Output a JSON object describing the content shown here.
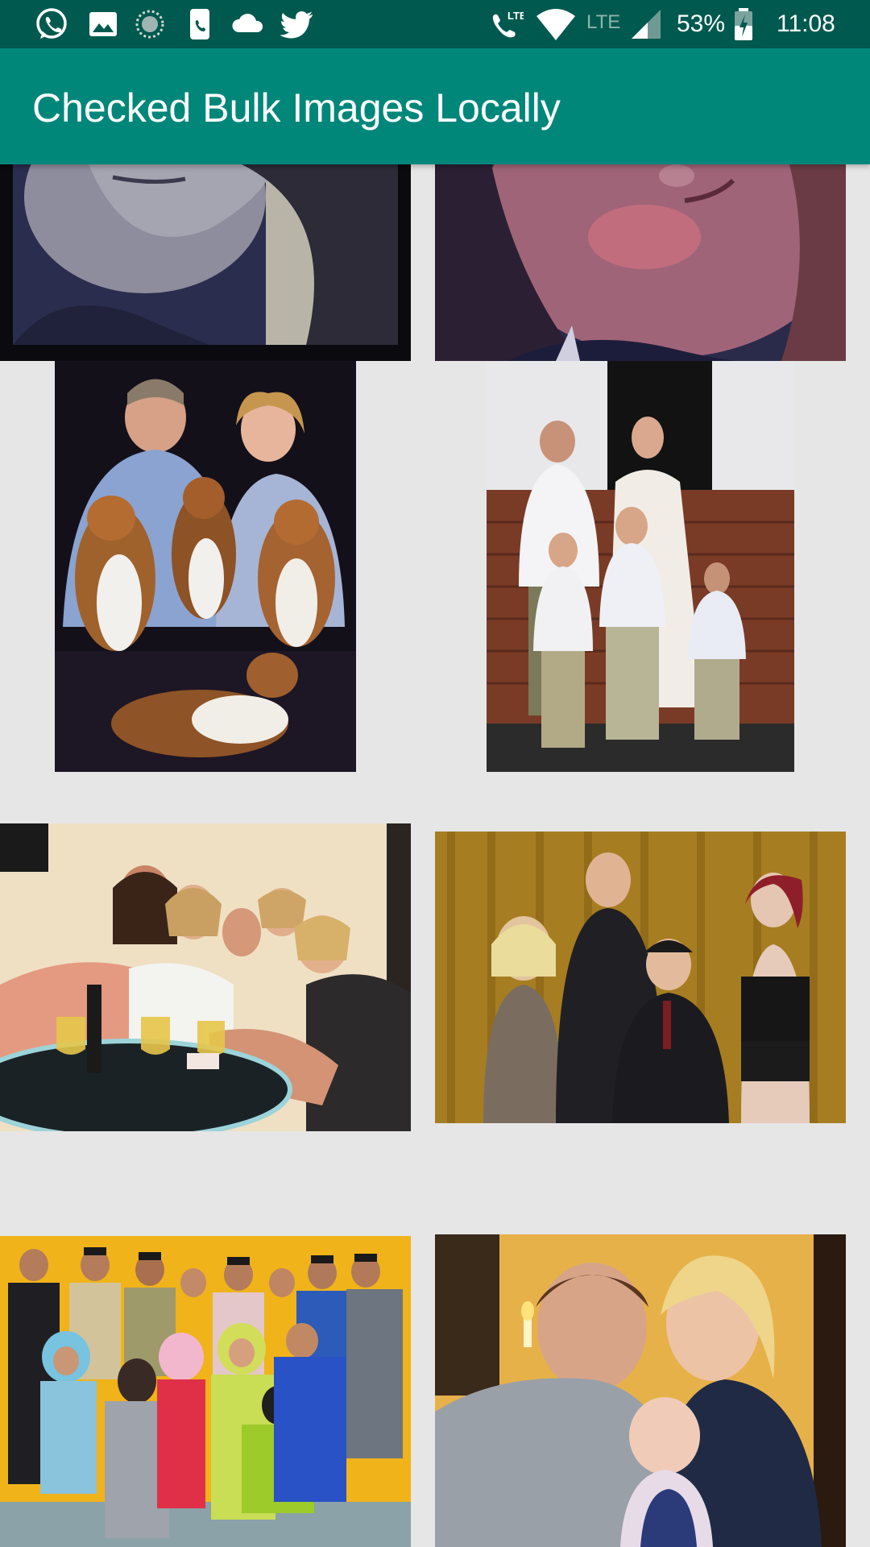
{
  "status_bar": {
    "battery": "53%",
    "time": "11:08",
    "network_label": "LTE",
    "icons": [
      "whatsapp-icon",
      "gallery-icon",
      "sync-icon",
      "phone-app-icon",
      "cloud-icon",
      "twitter-icon",
      "volte-call-icon",
      "wifi-icon",
      "signal-icon",
      "battery-icon"
    ],
    "colors": {
      "background": "#00594f",
      "icon": "#ffffff"
    }
  },
  "app_bar": {
    "title": "Checked Bulk Images Locally",
    "color": "#00877a"
  },
  "grid": {
    "background": "#e6e6e6",
    "columns": 2,
    "images": [
      {
        "subject": "close-up selfie of a woman with dark hair, blue tint"
      },
      {
        "subject": "close-up selfie of a red-haired woman, pink tint"
      },
      {
        "subject": "couple posing with four sheltie dogs"
      },
      {
        "subject": "wedding couple with three boys on brick steps"
      },
      {
        "subject": "group of young women around a table with wine glasses"
      },
      {
        "subject": "four performers posing in front of gold curtain"
      },
      {
        "subject": "large family in traditional dress, yellow wall"
      },
      {
        "subject": "couple holding a baby"
      }
    ]
  }
}
